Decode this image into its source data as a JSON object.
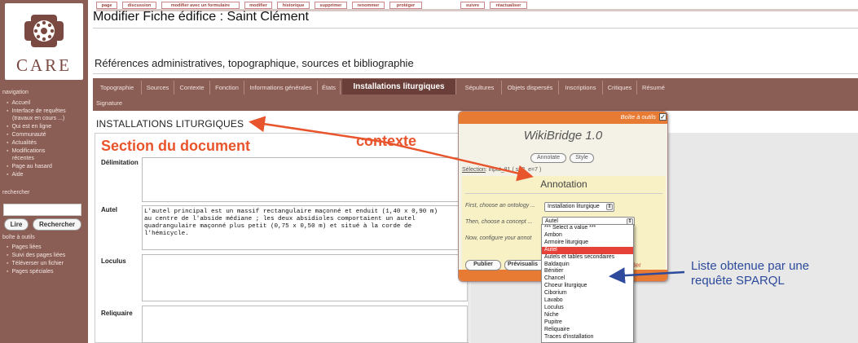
{
  "sidebar": {
    "logo_text": "CARE",
    "nav_heading": "navigation",
    "nav_items": [
      "Accueil",
      "Interface de requêtes",
      "(travaux en cours ...)",
      "Qui est en ligne",
      "Communauté",
      "Actualités",
      "Modifications",
      "récentes",
      "Page au hasard",
      "Aide"
    ],
    "search_heading": "rechercher",
    "lire_label": "Lire",
    "rechercher_label": "Rechercher",
    "tools_heading": "boîte à outils",
    "tool_items": [
      "Pages liées",
      "Suivi des pages liées",
      "Téléverser un fichier",
      "Pages spéciales"
    ]
  },
  "top_tabs": [
    "page",
    "discussion",
    "modifier avec un formulaire",
    "modifier",
    "historique",
    "supprimer",
    "renommer",
    "protéger",
    "suivre",
    "réactualiser"
  ],
  "page_title": "Modifier Fiche édifice : Saint Clément",
  "subtitle": "Références administratives, topographique, sources et bibliographie",
  "section_tabs": [
    "Topographie",
    "Sources",
    "Contexte",
    "Fonction",
    "Informations générales",
    "États",
    "Installations liturgiques",
    "Sépultures",
    "Objets dispersés",
    "Inscriptions",
    "Critiques",
    "Résumé"
  ],
  "section_tab_row2": "Signature",
  "section_title": "INSTALLATIONS LITURGIQUES",
  "fields": {
    "delimitation_label": "Délimitation",
    "autel_label": "Autel",
    "autel_text": "L'autel principal est un massif rectangulaire maçonné et enduit (1,40 x 0,90 m)\nau centre de l'abside médiane ; les deux absidioles comportaient un autel\nquadrangulaire maçonné plus petit (0,75 x 0,50 m) et situé à la corde de\nl'hémicycle.",
    "loculus_label": "Loculus",
    "reliquaire_label": "Reliquaire"
  },
  "annotations": {
    "section_label": "Section du document",
    "contexte_label": "contexte",
    "liste_label": "Liste obtenue par une requête SPARQL"
  },
  "wikibridge": {
    "toolbox_label": "Boîte à outils",
    "title": "WikiBridge 1.0",
    "annotate_label": "Annotate",
    "style_label": "Style",
    "selection_label": "Sélection",
    "selection_value": ": input_81 ( s=2, e=7 )",
    "annotation_title": "Annotation",
    "step1": "First, choose an ontology ...",
    "ontology_value": "Installation liturgique",
    "step2": "Then, choose a concept ...",
    "concept_value": "Autel",
    "step3": "Now, configure your annot",
    "publier_label": "Publier",
    "previsualiser_label": "Prévisualis",
    "annuler_label": "nuler"
  },
  "dropdown": {
    "items": [
      "*** Select a value ***",
      "Ambon",
      "Armoire liturgique",
      "Autel",
      "Autels et tables secondaires",
      "Baldaquin",
      "Bénitier",
      "Chancel",
      "Choeur liturgique",
      "Ciborium",
      "Lavabo",
      "Loculus",
      "Niche",
      "Pupitre",
      "Reliquaire",
      "Traces d'installation"
    ],
    "selected_index": 3
  },
  "colors": {
    "sidebar": "#8a5d55",
    "active_tab": "#6b3f39",
    "annotation_orange": "#e8542b",
    "annotation_blue": "#2d4a9c",
    "wikibridge_bar": "#e87b34",
    "dropdown_selected": "#e7423a"
  }
}
